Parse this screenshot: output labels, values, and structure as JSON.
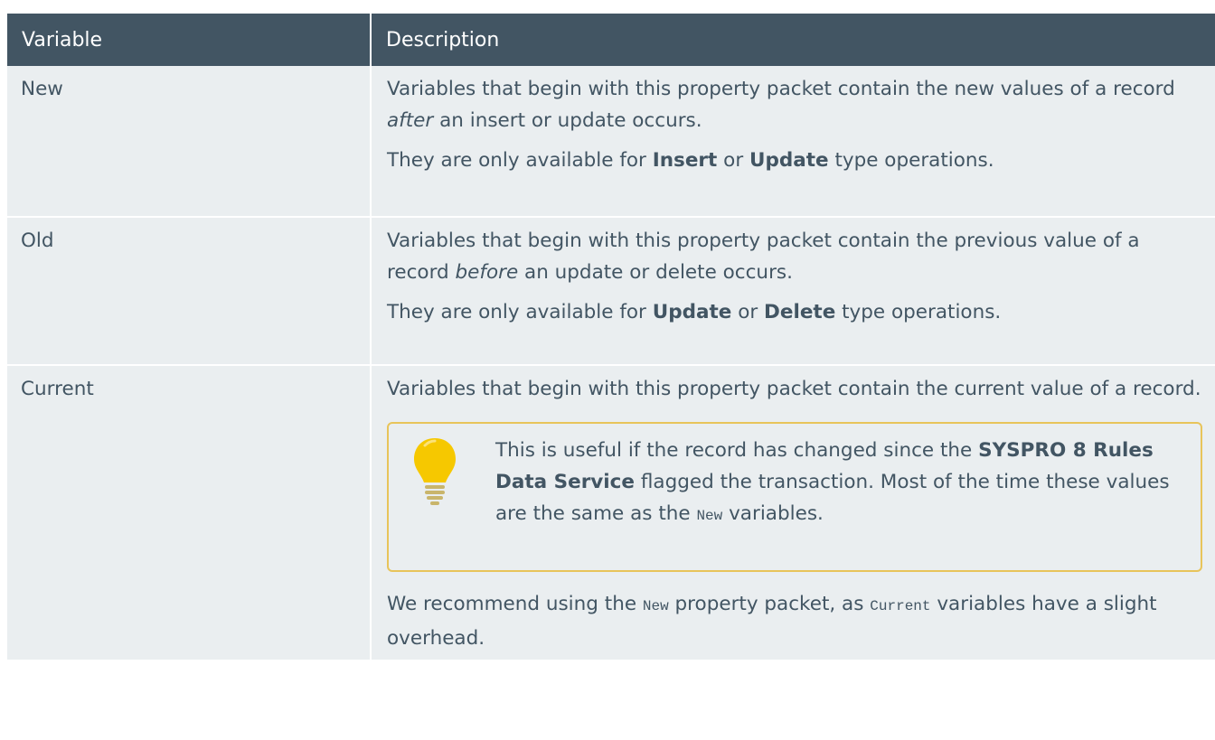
{
  "table": {
    "headers": [
      "Variable",
      "Description"
    ],
    "rows": [
      {
        "variable": "New",
        "p1": {
          "pre": "Variables that begin with this property packet contain the new values of a record ",
          "em": "after",
          "post": " an insert or update occurs."
        },
        "p2": {
          "pre": "They are only available for ",
          "b1": "Insert",
          "mid": " or ",
          "b2": "Update",
          "post": " type operations."
        }
      },
      {
        "variable": "Old",
        "p1": {
          "pre": "Variables that begin with this property packet contain the previous value of a record ",
          "em": "before",
          "post": " an update or delete occurs."
        },
        "p2": {
          "pre": "They are only available for ",
          "b1": "Update",
          "mid": " or ",
          "b2": "Delete",
          "post": " type operations."
        }
      },
      {
        "variable": "Current",
        "p1": "Variables that begin with this property packet contain the current value of a record.",
        "note": {
          "icon": "lightbulb-icon",
          "pre": "This is useful if the record has changed since the ",
          "bold": "SYSPRO 8 Rules Data Service",
          "mid": " flagged the transaction. Most of the time these values are the same as the ",
          "code": "New",
          "post": " variables."
        },
        "p3": {
          "pre": "We recommend using the ",
          "code1": "New",
          "mid": " property packet, as ",
          "code2": "Current",
          "post": " variables have a slight overhead."
        }
      }
    ]
  },
  "colors": {
    "header_bg": "#425563",
    "header_text": "#ffffff",
    "row_bg": "#eaeef0",
    "body_text": "#425563",
    "note_border": "#e8c45a",
    "bulb_yellow": "#f6c800"
  }
}
